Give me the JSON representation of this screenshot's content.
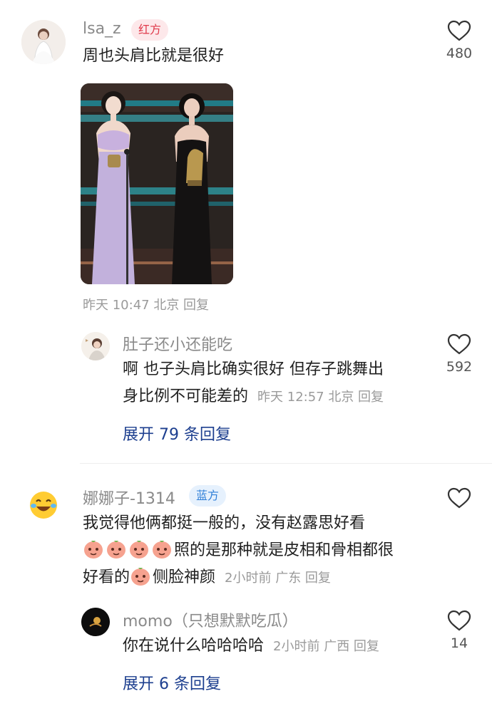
{
  "comments": [
    {
      "username": "lsa_z",
      "badge": "红方",
      "text": "周也头肩比就是很好",
      "meta": "昨天 10:47 北京 回复",
      "likes": "480",
      "reply": {
        "username": "肚子还小还能吃",
        "text_line1": "啊 也子头肩比确实很好 但存子跳舞出",
        "text_line2": "身比例不可能差的",
        "meta": "昨天 12:57 北京 回复",
        "likes": "592"
      },
      "expand": "展开 79 条回复"
    },
    {
      "username": "娜娜子-1314",
      "badge": "蓝方",
      "text_line1": "我觉得他俩都挺一般的，没有赵露思好看",
      "text_line2": "照的是那种就是皮相和骨相都很",
      "text_line3a": "好看的",
      "text_line3b": "侧脸神颜",
      "meta": "2小时前 广东 回复",
      "reply": {
        "username": "momo（只想默默吃瓜）",
        "text": "你在说什么哈哈哈哈",
        "meta": "2小时前 广西 回复",
        "likes": "14"
      },
      "expand": "展开 6 条回复"
    }
  ],
  "colors": {
    "accent_link": "#1d3f8f",
    "badge_red": "#e0394a",
    "badge_blue": "#2f7fd8",
    "meta_gray": "#9a9a9a"
  },
  "icons": {
    "like": "heart-outline-icon",
    "emoji": "peach-face-emoji",
    "laugh": "laughing-tears-emoji"
  }
}
